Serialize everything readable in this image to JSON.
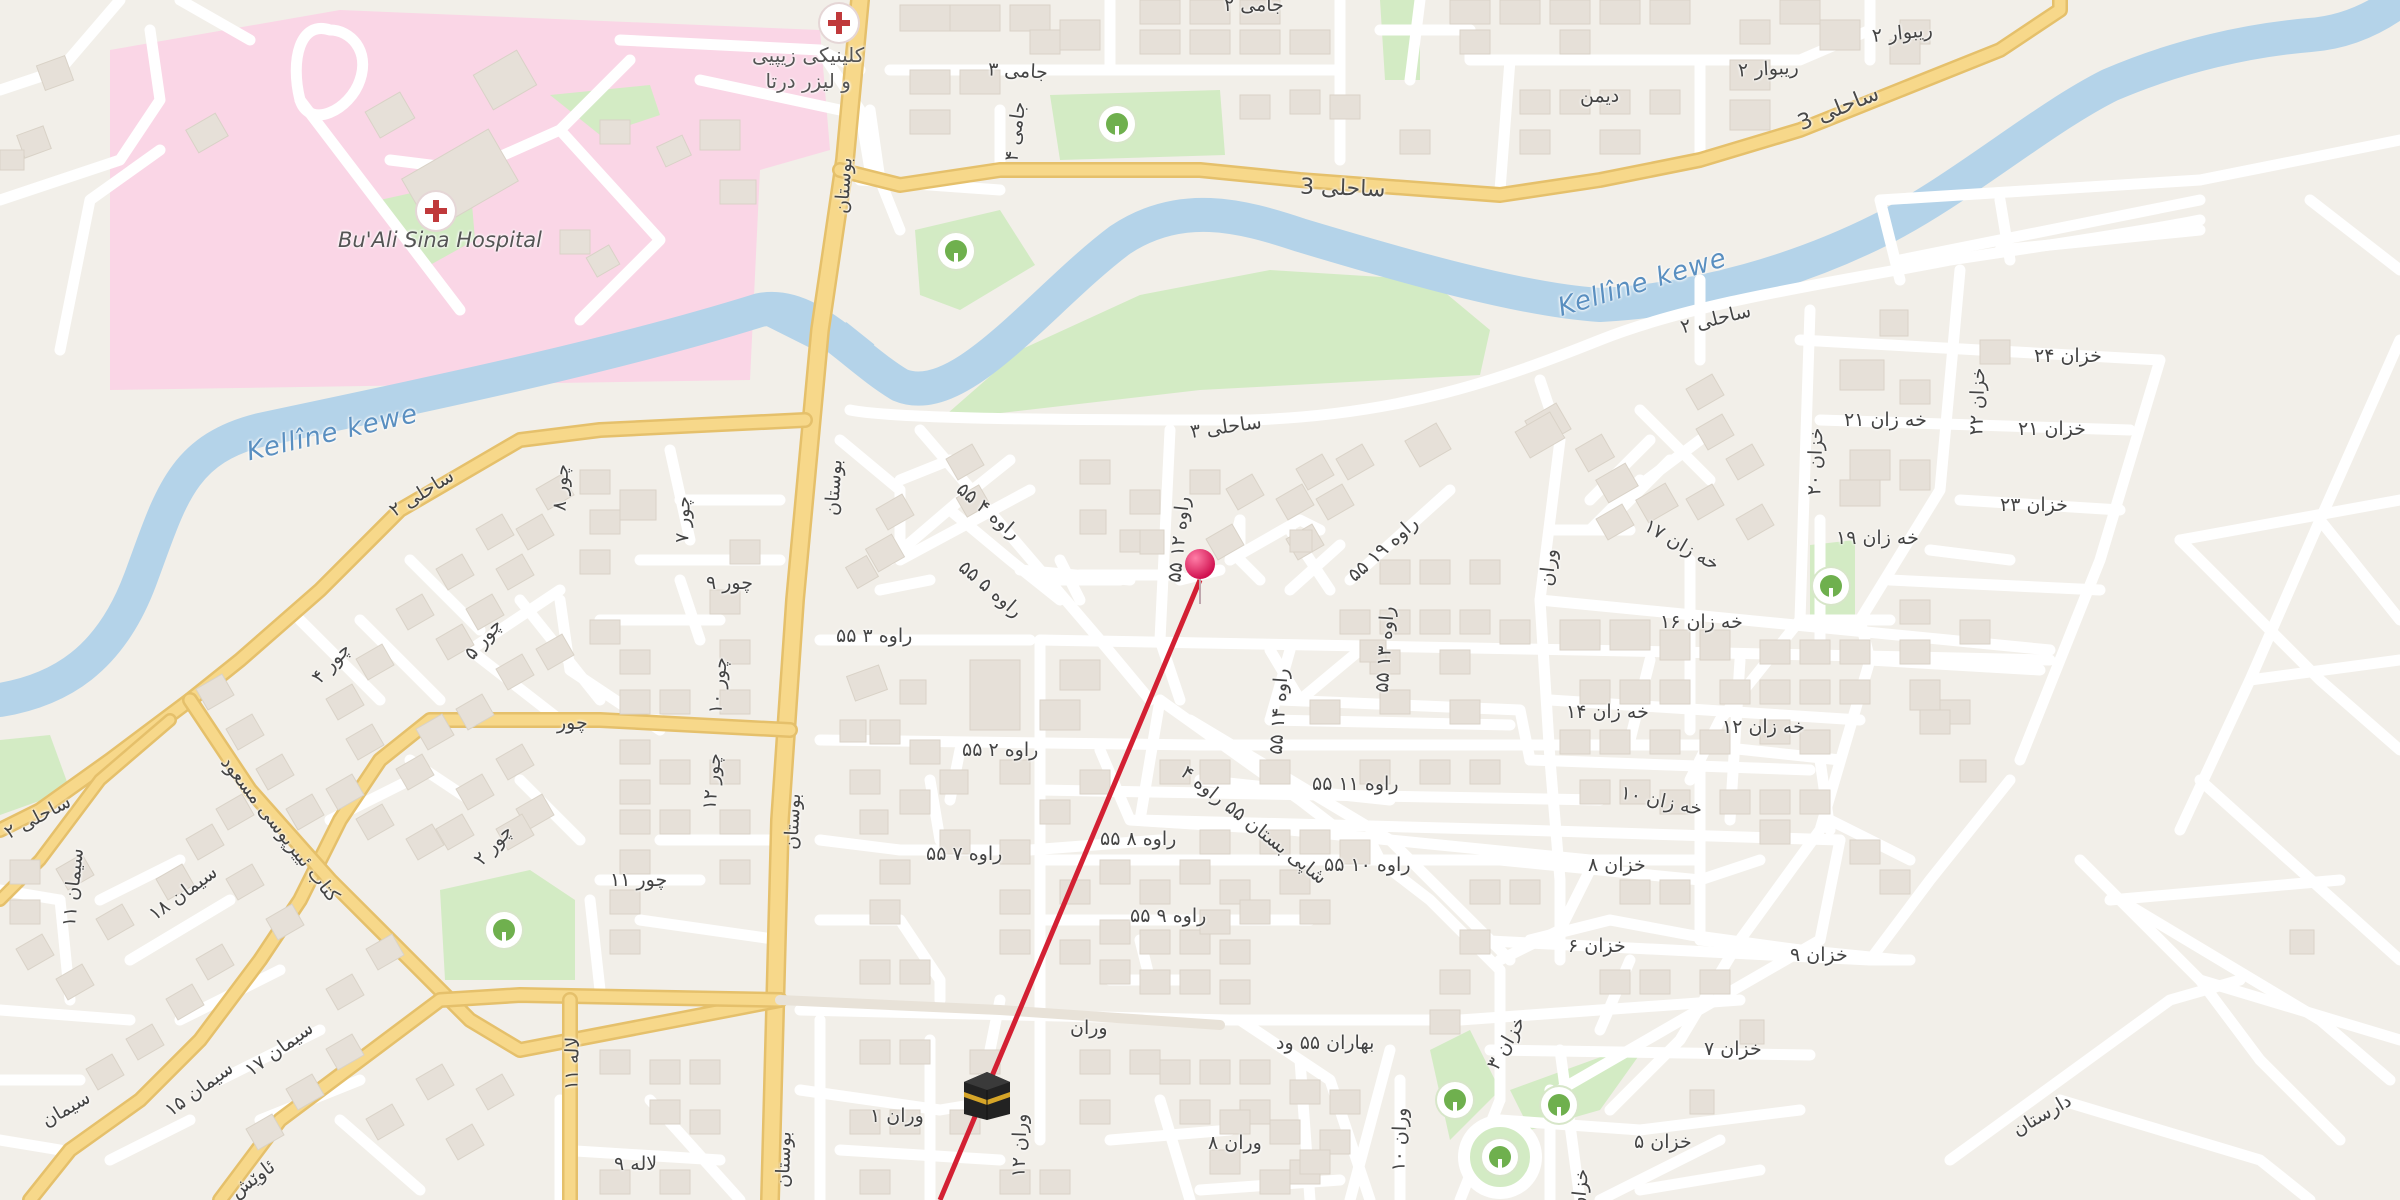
{
  "map": {
    "colors": {
      "background": "#f2efe9",
      "hospital_area": "#fad6e6",
      "park": "#d3ebc4",
      "water": "#b4d3e9",
      "major_road": "#f7d88a",
      "minor_road": "#ffffff",
      "building": "#e6e0d8",
      "route_line": "#d32033",
      "pin": "#e2245c"
    },
    "labels": {
      "hospital": "Bu'Ali Sina Hospital",
      "clinic_line1": "کلینیکی زیپیی",
      "clinic_line2": "و لیزر درتا",
      "river_west": "Kellîne kewe",
      "river_east": "Kellîne kewe",
      "sahili3_a": "ساحلی 3",
      "sahili3_b": "ساحلی 3",
      "sahili2_e": "ساحلی ۲",
      "sahili3_mid": "ساحلی ۳",
      "sahili2_w": "ساحلی ۲",
      "sahili2_sw": "ساحلی ۲",
      "jami2": "جامی ۲",
      "jami3": "جامی ۳",
      "jami4": "جامی ۴",
      "reybwar2a": "ریبوار ۲",
      "reybwar2b": "ریبوار ۲",
      "desmen": "دیمن",
      "bostan_n": "بوستان",
      "bostan_m": "بوستان",
      "bostan_s": "بوستان",
      "bostan_ss": "بوستان",
      "raw55_2": "راوه ۲",
      "raw55_3": "۵۵ راوه ۳",
      "raw55_4": "۵۵ راوه ۴",
      "raw55_5": "۵۵ راوه ۵",
      "raw55_12": "۵۵ راوه ۱۲",
      "raw55_19": "۵۵ راوه ۱۹",
      "raw55_13": "۵۵ راوه ۱۳",
      "raw55_14": "۵۵ راوه ۱۴",
      "raw55_2b": "۵۵ راوه ۲",
      "raw55_11": "۵۵ راوه ۱۱",
      "raw55_8": "۵۵ راوه ۸",
      "raw55_7": "۵۵ راوه ۷",
      "raw55_10": "۵۵ راوه ۱۰",
      "raw55_9": "۵۵ راوه ۹",
      "khan24": "خزان ۲۴",
      "khan22": "خزان ۲۲",
      "khan21a": "خه زان ۲۱",
      "khan21b": "خزان ۲۱",
      "khan20": "خزان ۲۰",
      "khan23": "خزان ۲۳",
      "khan19": "خه زان ۱۹",
      "khan17": "خه زان ۱۷",
      "khan16": "خه زان ۱۶",
      "khan14": "خه زان ۱۴",
      "khan12": "خه زان ۱۲",
      "khan10": "خه زان ۱۰",
      "khan8": "خزان ۸",
      "khan6": "خزان ۶",
      "khan9": "خزان ۹",
      "khan7": "خزان ۷",
      "khan5": "خزان ۵",
      "khan3": "خزان ۳",
      "khan_v": "خزان",
      "wrin": "وران",
      "wrin_mid": "وران",
      "wrin1": "وران ۱",
      "wrin8": "وران ۸",
      "wrin10": "وران ۱۰",
      "wrin12": "وران ۱۲",
      "bahar": "بهاران ۵۵ ود",
      "darsat": "دارستان",
      "chawr": "چور",
      "chawr2": "چور ۲",
      "chawr3": "چور ۳",
      "chawr4": "چور ۴",
      "chawr5": "چور ۵",
      "chawr7": "چور ۷",
      "chawr8": "چور ۸",
      "chawr9": "چور ۹",
      "chawr10": "چور ۱۰",
      "chawr11": "چور ۱۱",
      "chawr12": "چور ۱۲",
      "ghazni": "کتاب ئییرپوسی مسعود",
      "ghazni2": "کاک ئیبراهیم",
      "siman11": "سیمان ۱۱",
      "siman18": "سیمان ۱۸",
      "siman17": "سیمان ۱۷",
      "siman15": "سیمان ۱۵",
      "siman_sw": "سیمان",
      "lala9": "لاله ۹",
      "lala_v": "لاله ۱۱",
      "awesh": "ئاوێش",
      "shahid": "شاپی بستان ۵۵ راوه ۴"
    }
  }
}
